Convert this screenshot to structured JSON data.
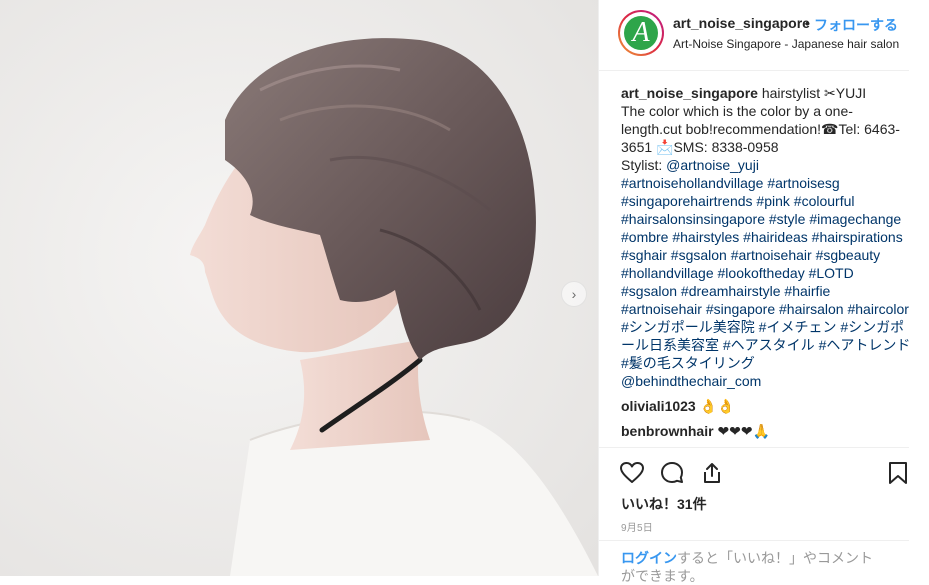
{
  "post": {
    "username": "art_noise_singapore",
    "separator": "•",
    "follow_label": "フォローする",
    "location": "Art-Noise Singapore - Japanese hair salon",
    "avatar_letter": "A",
    "next_arrow": "›"
  },
  "caption": {
    "username": "art_noise_singapore",
    "text": " hairstylist ✂YUJI\nThe color which is the color by a one-length.cut bob!recommendation!☎Tel: 6463-3651 📩SMS: 8338-0958\nStylist: ",
    "stylist_mention": "@artnoise_yuji",
    "hashtags": "\n#artnoisehollandvillage #artnoisesg #singaporehairtrends #pink #colourful #hairsalonsinsingapore #style #imagechange #ombre #hairstyles #hairideas #hairspirations #sghair #sgsalon #artnoisehair #sgbeauty #hollandvillage #lookoftheday #LOTD #sgsalon #dreamhairstyle #hairfie #artnoisehair #singapore #hairsalon #haircolor #シンガポール美容院 #イメチェン #シンガポール日系美容室 #ヘアスタイル #ヘアトレンド #髪の毛スタイリング\n@behindthechair_com"
  },
  "comments": [
    {
      "user": "oliviali1023",
      "text": " 👌👌"
    },
    {
      "user": "benbrownhair",
      "text": " ❤❤❤🙏"
    }
  ],
  "actions": {
    "like_icon": "heart-icon",
    "comment_icon": "comment-icon",
    "share_icon": "share-icon",
    "save_icon": "bookmark-icon"
  },
  "likes": "いいね！31件",
  "date": "9月5日",
  "login": {
    "link": "ログイン",
    "text": "すると「いいね！」やコメントができます。"
  },
  "colors": {
    "accent": "#3897f0",
    "hashtag": "#003569",
    "logo_green": "#2ea54a"
  }
}
